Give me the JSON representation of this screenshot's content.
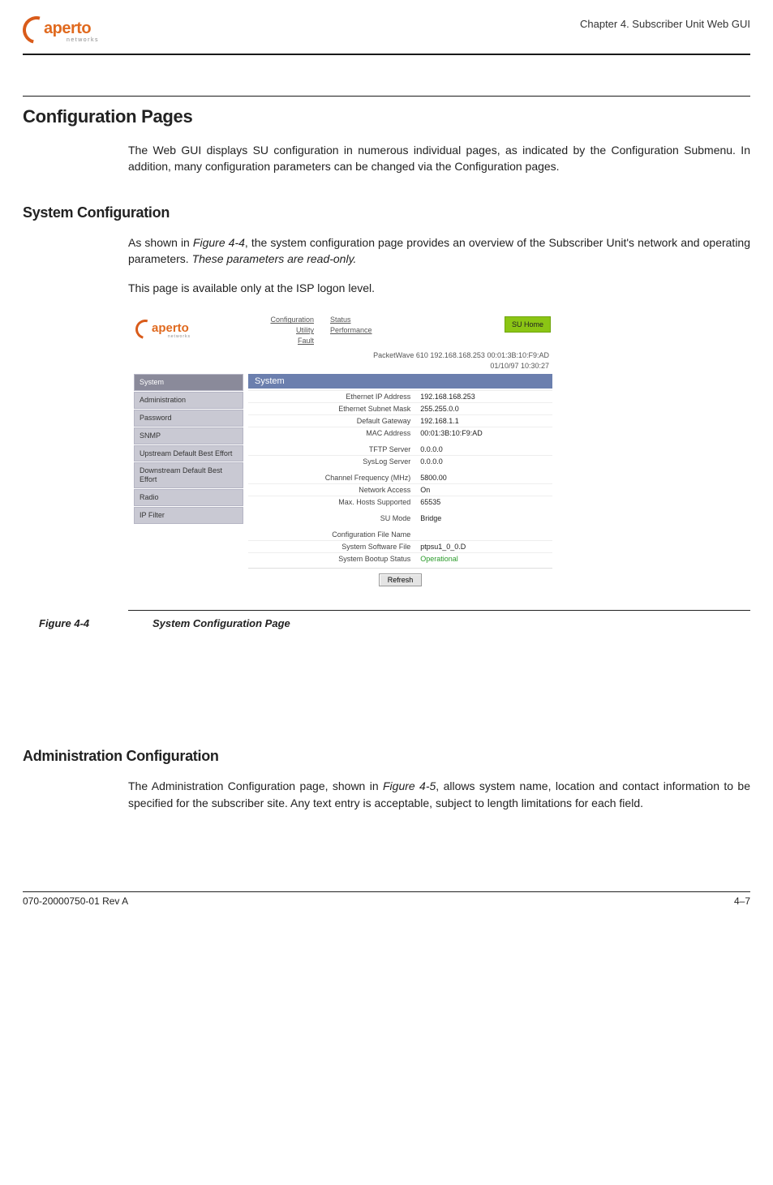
{
  "header": {
    "logo_text": "aperto",
    "logo_sub": "networks",
    "chapter": "Chapter 4.  Subscriber Unit Web GUI"
  },
  "section": {
    "title": "Configuration Pages",
    "intro": "The Web GUI displays SU configuration in numerous individual pages, as indicated by the Configuration Submenu. In addition, many configuration parameters can be changed via the Configuration pages."
  },
  "sysconf": {
    "title": "System Configuration",
    "p1a": "As shown in ",
    "p1_figref": "Figure 4-4",
    "p1b": ", the system configuration page provides an overview of the Subscriber Unit's network and operating parameters. ",
    "p1_readonly": "These parameters are read-only.",
    "p2": "This page is available only at the ISP logon level."
  },
  "screenshot": {
    "nav_col1": [
      "Configuration",
      "Utility",
      "Fault"
    ],
    "nav_col2": [
      "Status",
      "Performance"
    ],
    "su_home": "SU Home",
    "status_line1": "PacketWave 610    192.168.168.253    00:01:3B:10:F9:AD",
    "status_line2": "01/10/97    10:30:27",
    "sidebar": [
      "System",
      "Administration",
      "Password",
      "SNMP",
      "Upstream Default Best Effort",
      "Downstream Default Best Effort",
      "Radio",
      "IP Filter"
    ],
    "content_title": "System",
    "rows": [
      {
        "label": "Ethernet IP Address",
        "value": "192.168.168.253",
        "gap": false
      },
      {
        "label": "Ethernet Subnet Mask",
        "value": "255.255.0.0",
        "gap": false
      },
      {
        "label": "Default Gateway",
        "value": "192.168.1.1",
        "gap": false
      },
      {
        "label": "MAC Address",
        "value": "00:01:3B:10:F9:AD",
        "gap": false
      },
      {
        "label": "TFTP Server",
        "value": "0.0.0.0",
        "gap": true
      },
      {
        "label": "SysLog Server",
        "value": "0.0.0.0",
        "gap": false
      },
      {
        "label": "Channel Frequency (MHz)",
        "value": "5800.00",
        "gap": true
      },
      {
        "label": "Network Access",
        "value": "On",
        "gap": false
      },
      {
        "label": "Max. Hosts Supported",
        "value": "65535",
        "gap": false
      },
      {
        "label": "SU Mode",
        "value": "Bridge",
        "gap": true
      },
      {
        "label": "Configuration File Name",
        "value": "",
        "gap": true
      },
      {
        "label": "System Software File",
        "value": "ptpsu1_0_0.D",
        "gap": false
      },
      {
        "label": "System Bootup Status",
        "value": "Operational",
        "gap": false,
        "operational": true
      }
    ],
    "refresh": "Refresh"
  },
  "figure": {
    "num": "Figure 4-4",
    "title": "System Configuration Page"
  },
  "admin": {
    "title": "Administration Configuration",
    "p1a": "The Administration Configuration page, shown in ",
    "p1_figref": "Figure 4-5",
    "p1b": ", allows system name, location and contact information to be specified for the subscriber site. Any text entry is accept­able, subject to length limitations for each field."
  },
  "footer": {
    "left": "070-20000750-01 Rev A",
    "right": "4–7"
  }
}
